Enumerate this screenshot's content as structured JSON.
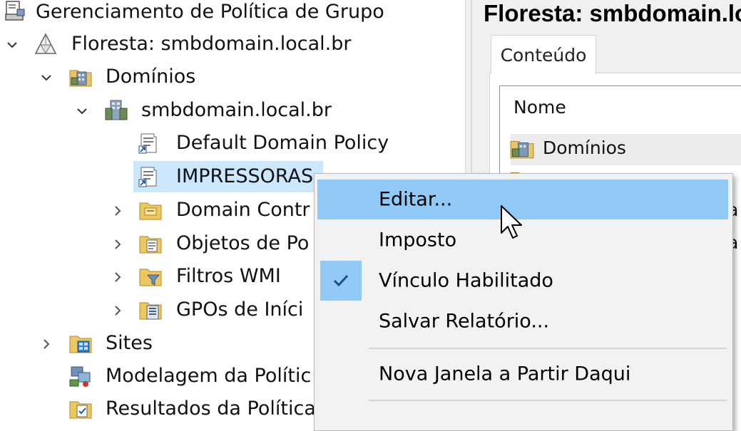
{
  "tree": {
    "root": {
      "label": "Gerenciamento de Política de Grupo",
      "icon": "gpm-console-icon"
    },
    "forest": {
      "label": "Floresta: smbdomain.local.br",
      "icon": "forest-icon"
    },
    "domains": {
      "label": "Domínios",
      "icon": "domains-folder-icon"
    },
    "domain": {
      "label": "smbdomain.local.br",
      "icon": "domain-icon"
    },
    "gpo_links": [
      {
        "label": "Default Domain Policy",
        "icon": "gpo-link-icon"
      },
      {
        "label": "IMPRESSORAS",
        "icon": "gpo-link-icon",
        "selected": true
      }
    ],
    "sub_containers": [
      {
        "label": "Domain Contr",
        "icon": "ou-folder-icon"
      },
      {
        "label": "Objetos de Po",
        "icon": "gpo-folder-icon"
      },
      {
        "label": "Filtros WMI",
        "icon": "wmi-filter-folder-icon"
      },
      {
        "label": "GPOs de Iníci",
        "icon": "starter-gpo-folder-icon"
      }
    ],
    "sites": {
      "label": "Sites",
      "icon": "sites-folder-icon"
    },
    "modeling": {
      "label": "Modelagem da Polític",
      "icon": "modeling-icon"
    },
    "results": {
      "label": "Resultados da Política",
      "icon": "results-icon"
    }
  },
  "right_pane": {
    "title": "Floresta: smbdomain.local.br",
    "tab_label": "Conteúdo",
    "column_header": "Nome",
    "rows": [
      {
        "label": "Domínios",
        "icon": "domains-folder-icon"
      }
    ],
    "fragment_a": "a",
    "fragment_b": "a"
  },
  "context_menu": {
    "items": [
      {
        "label": "Editar...",
        "highlighted": true
      },
      {
        "label": "Imposto"
      },
      {
        "label": "Vínculo Habilitado",
        "checked": true
      },
      {
        "label": "Salvar Relatório..."
      },
      {
        "label": "Nova Janela a Partir Daqui"
      }
    ]
  },
  "colors": {
    "selection": "#cce8ff",
    "menu_highlight": "#91c9f7",
    "menu_background": "#f2f2f2"
  }
}
